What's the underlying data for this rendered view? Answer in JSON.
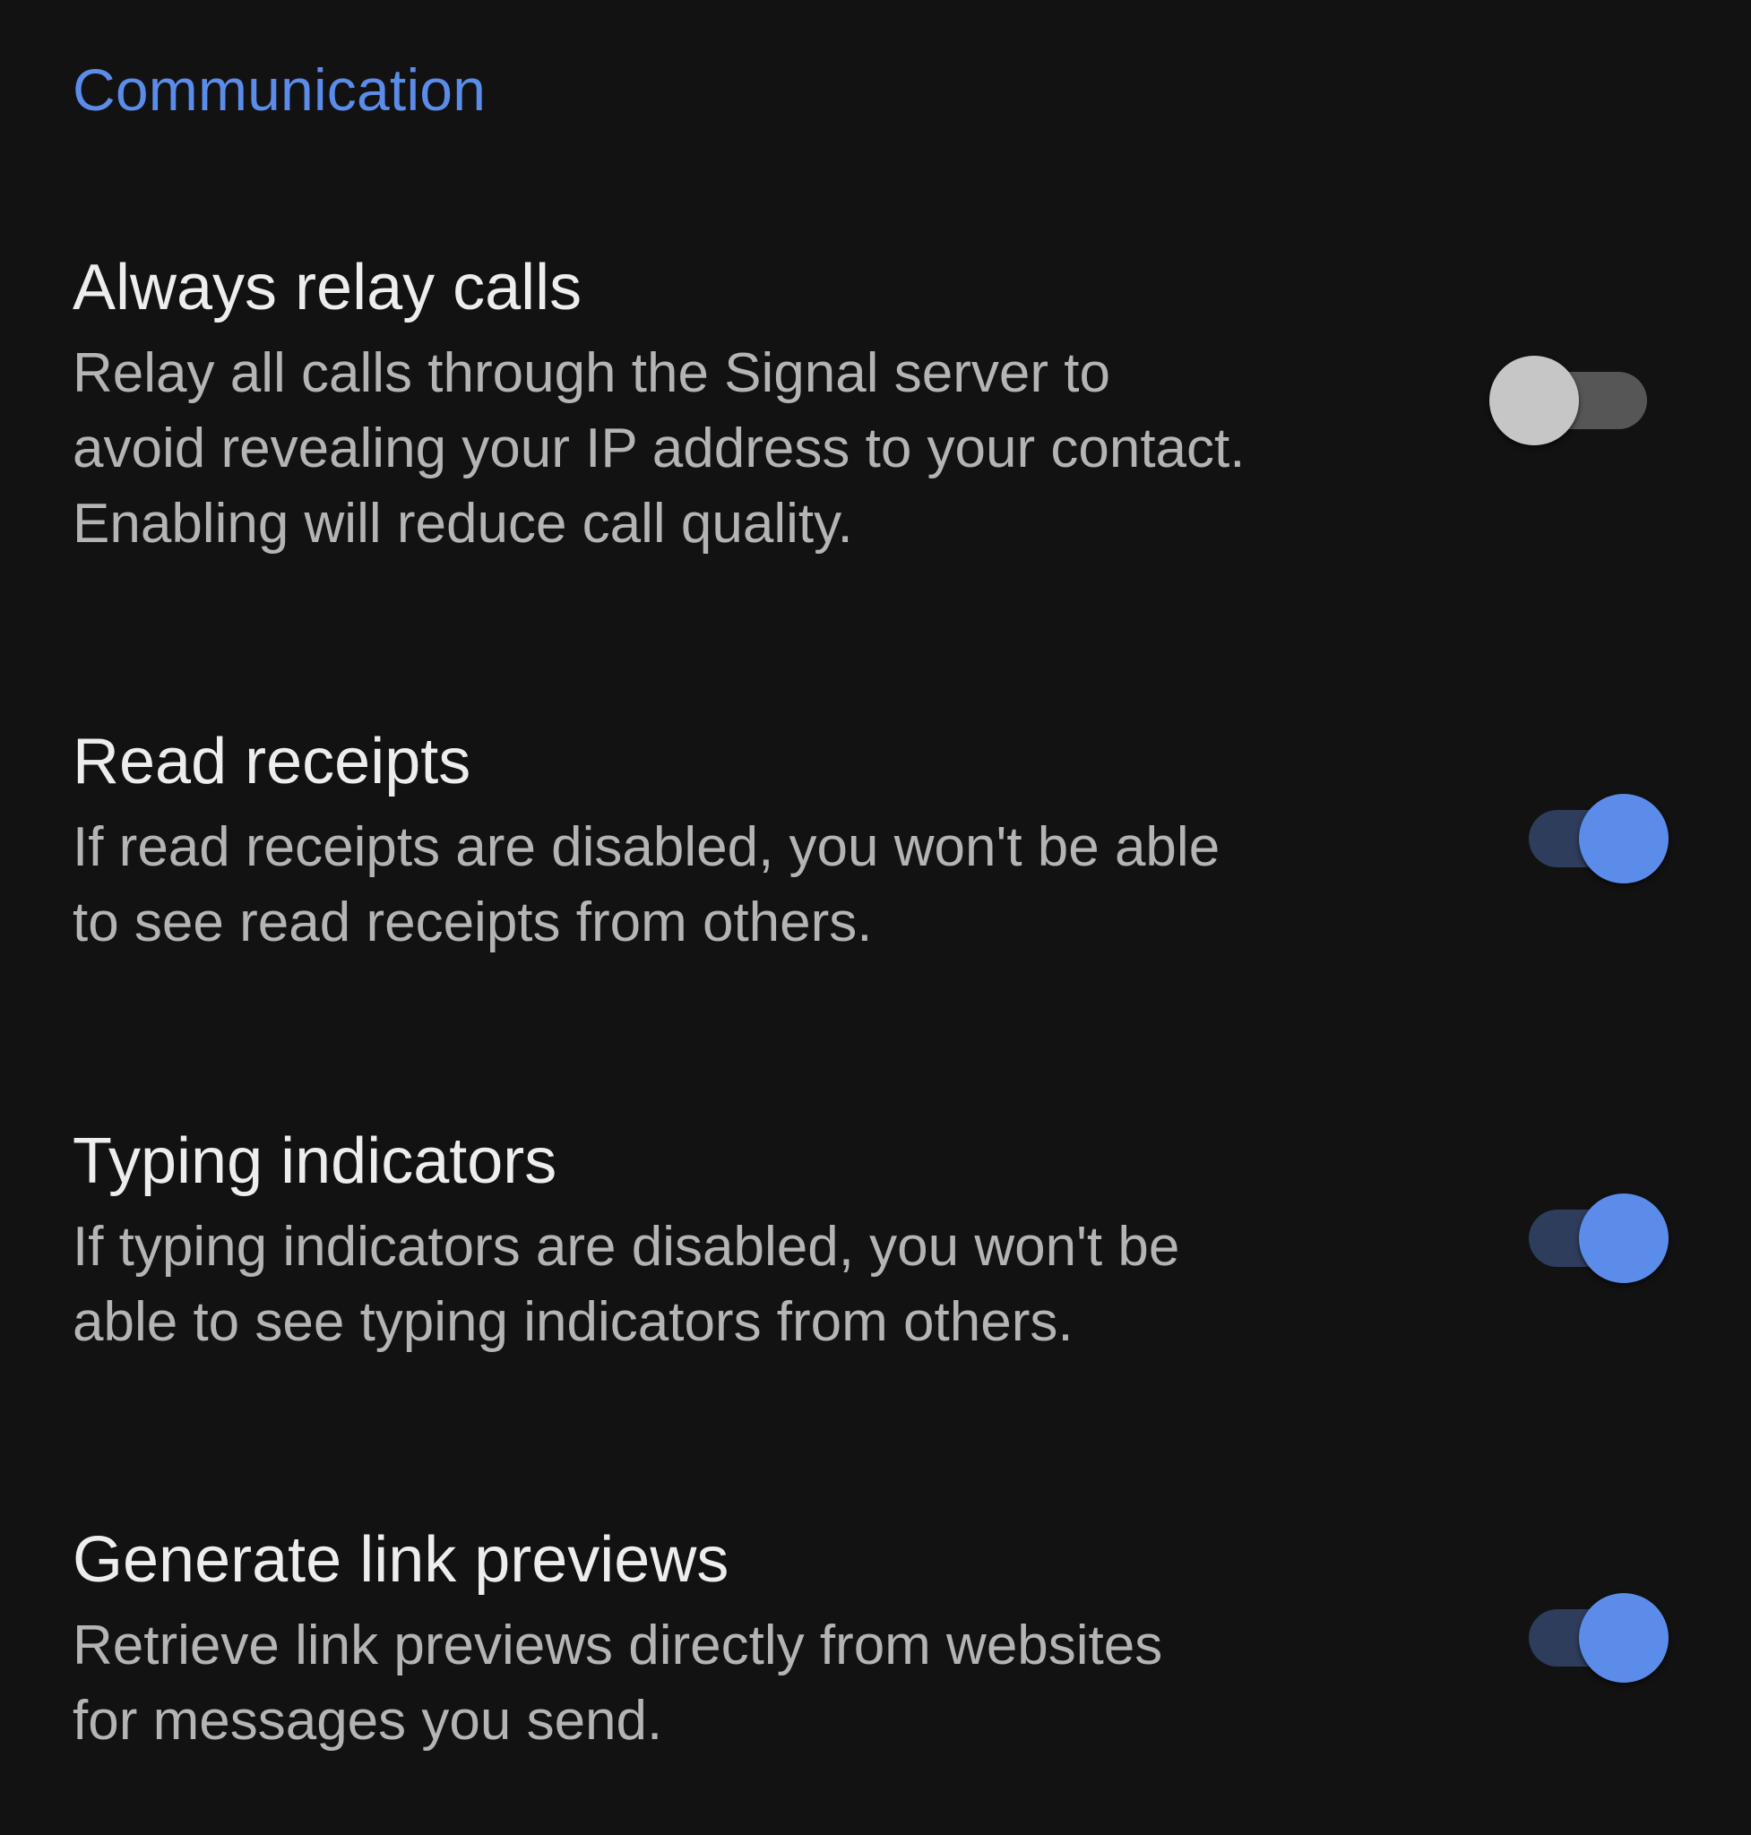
{
  "section": {
    "title": "Communication"
  },
  "preferences": [
    {
      "title": "Always relay calls",
      "summary_lines": [
        "Relay all calls through the Signal server to",
        "avoid revealing your IP address to your contact.",
        "Enabling will reduce call quality."
      ],
      "enabled": false
    },
    {
      "title": "Read receipts",
      "summary_lines": [
        "If read receipts are disabled, you won't be able",
        "to see read receipts from others."
      ],
      "enabled": true
    },
    {
      "title": "Typing indicators",
      "summary_lines": [
        "If typing indicators are disabled, you won't be",
        "able to see typing indicators from others."
      ],
      "enabled": true
    },
    {
      "title": "Generate link previews",
      "summary_lines": [
        "Retrieve link previews directly from websites",
        "for messages you send."
      ],
      "enabled": true
    }
  ],
  "colors": {
    "background": "#121212",
    "accent": "#5b8cea",
    "title_text": "#ededed",
    "summary_text": "#b4b4b4",
    "switch_off_track": "#565656",
    "switch_off_thumb": "#c6c6c6",
    "switch_on_track": "#2e3d5c",
    "switch_on_thumb": "#5b8cea"
  }
}
